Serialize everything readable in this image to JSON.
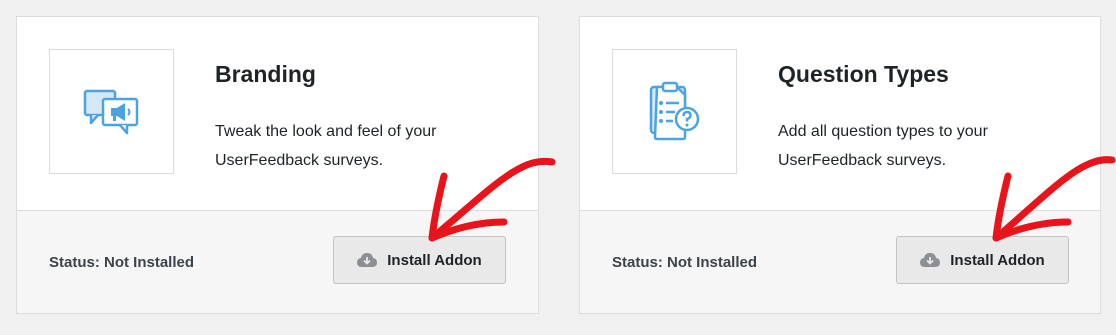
{
  "colors": {
    "accent_blue": "#4ba3e0",
    "annotation_red": "#e8141b",
    "page_bg": "#f0f0f1"
  },
  "addons": [
    {
      "icon": "megaphone-chat-icon",
      "title": "Branding",
      "description": "Tweak the look and feel of your UserFeedback surveys.",
      "status": "Status: Not Installed",
      "button_icon": "cloud-download-icon",
      "button_label": "Install Addon"
    },
    {
      "icon": "question-checklist-icon",
      "title": "Question Types",
      "description": "Add all question types to your UserFeedback surveys.",
      "status": "Status: Not Installed",
      "button_icon": "cloud-download-icon",
      "button_label": "Install Addon"
    }
  ]
}
